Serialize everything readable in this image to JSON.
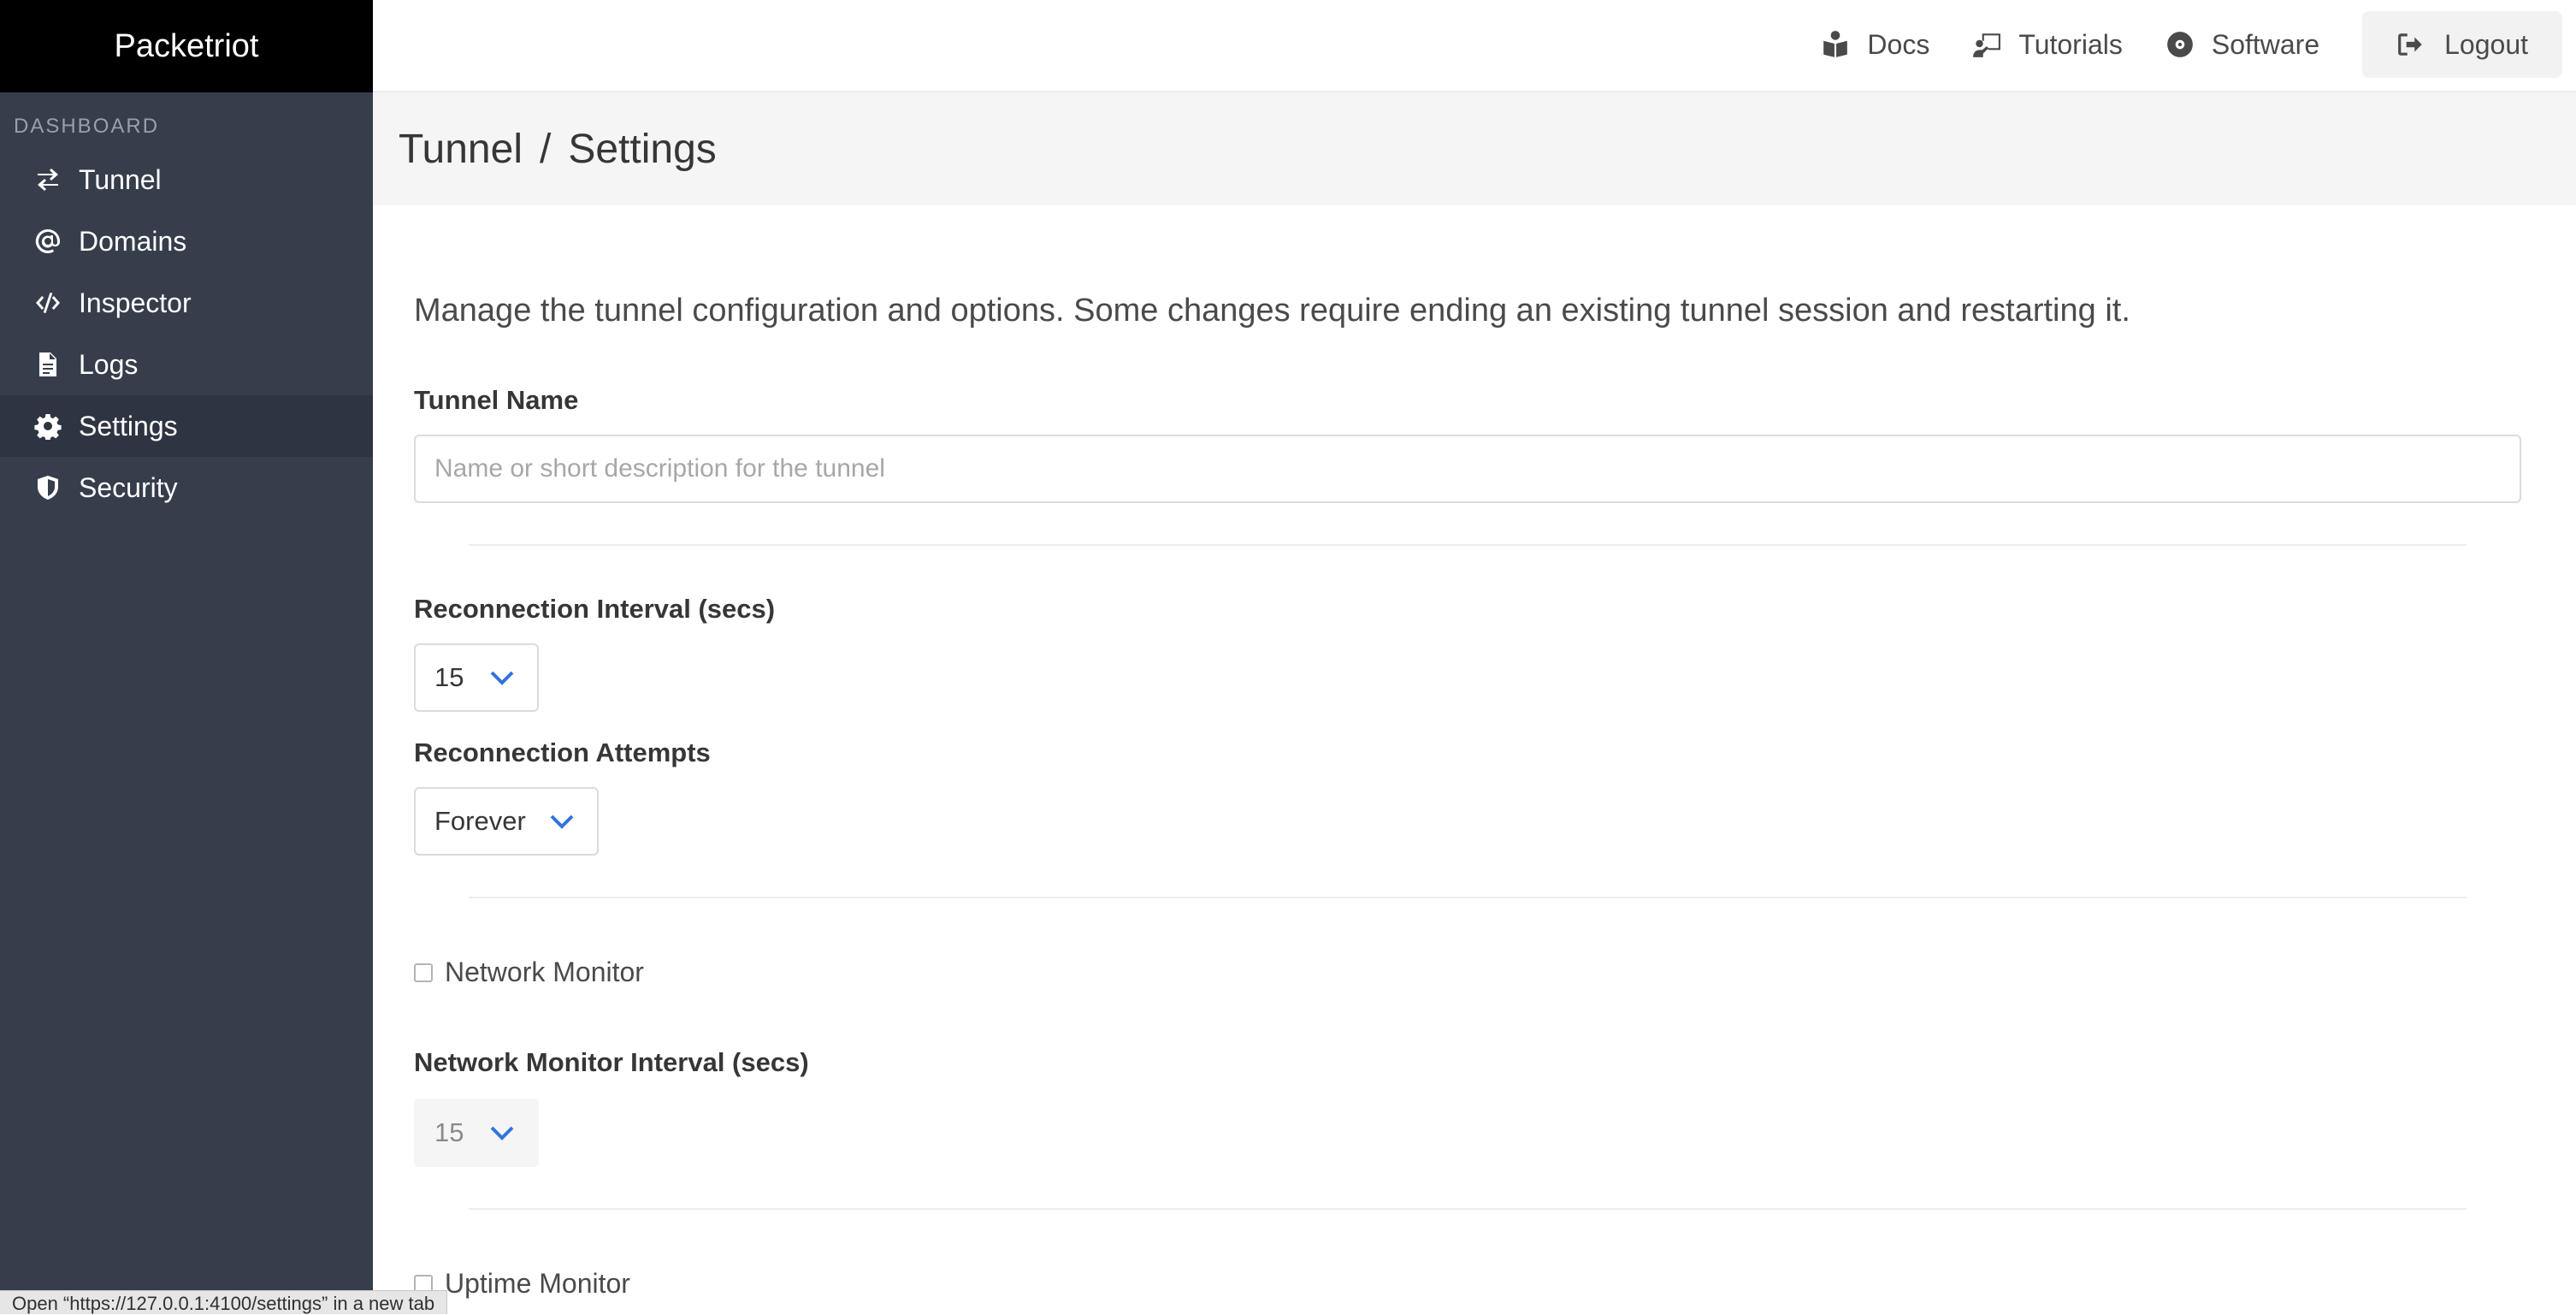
{
  "brand": "Packetriot",
  "sidebar": {
    "section_label": "DASHBOARD",
    "items": [
      {
        "label": "Tunnel",
        "icon": "exchange-icon"
      },
      {
        "label": "Domains",
        "icon": "at-icon"
      },
      {
        "label": "Inspector",
        "icon": "code-icon"
      },
      {
        "label": "Logs",
        "icon": "file-icon"
      },
      {
        "label": "Settings",
        "icon": "gear-icon",
        "active": true
      },
      {
        "label": "Security",
        "icon": "shield-icon"
      }
    ]
  },
  "topnav": {
    "docs": "Docs",
    "tutorials": "Tutorials",
    "software": "Software",
    "logout": "Logout"
  },
  "breadcrumb": {
    "parent": "Tunnel",
    "separator": "/",
    "current": "Settings"
  },
  "main": {
    "description": "Manage the tunnel configuration and options. Some changes require ending an existing tunnel session and restarting it.",
    "tunnel_name": {
      "label": "Tunnel Name",
      "placeholder": "Name or short description for the tunnel",
      "value": ""
    },
    "reconnection_interval": {
      "label": "Reconnection Interval (secs)",
      "value": "15"
    },
    "reconnection_attempts": {
      "label": "Reconnection Attempts",
      "value": "Forever"
    },
    "network_monitor": {
      "label": "Network Monitor",
      "checked": false
    },
    "network_monitor_interval": {
      "label": "Network Monitor Interval (secs)",
      "value": "15"
    },
    "uptime_monitor": {
      "label": "Uptime Monitor",
      "checked": false
    }
  },
  "status_bar": {
    "text": "Open “https://127.0.0.1:4100/settings” in a new tab"
  },
  "colors": {
    "sidebar_bg": "#363d4b",
    "brand_bg": "#000000",
    "accent": "#3273dc"
  }
}
